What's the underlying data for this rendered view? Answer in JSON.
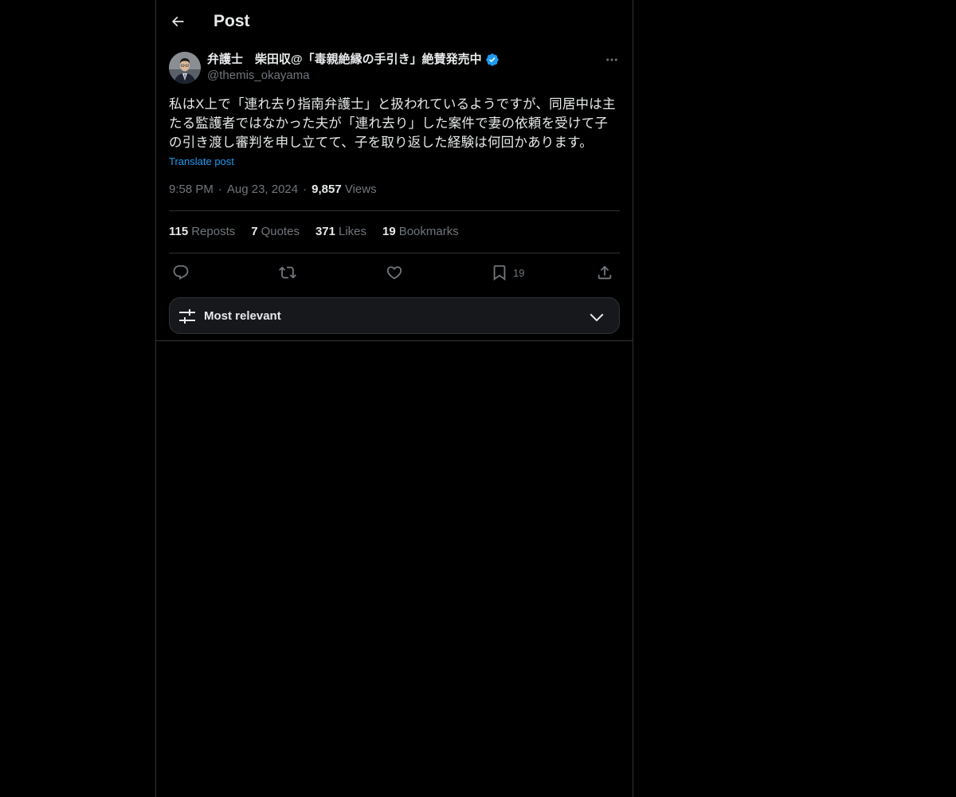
{
  "header": {
    "title": "Post"
  },
  "post": {
    "author_name": "弁護士　柴田収@「毒親絶縁の手引き」絶賛発売中",
    "handle": "@themis_okayama",
    "text": "私はX上で「連れ去り指南弁護士」と扱われているようですが、同居中は主たる監護者ではなかった夫が「連れ去り」した案件で妻の依頼を受けて子の引き渡し審判を申し立てて、子を取り返した経験は何回かあります。",
    "translate_label": "Translate post",
    "time": "9:58 PM",
    "date": "Aug 23, 2024",
    "views_count": "9,857",
    "views_label": "Views"
  },
  "stats": [
    {
      "count": "115",
      "label": "Reposts"
    },
    {
      "count": "7",
      "label": "Quotes"
    },
    {
      "count": "371",
      "label": "Likes"
    },
    {
      "count": "19",
      "label": "Bookmarks"
    }
  ],
  "actions": {
    "reply_icon": "reply-icon",
    "repost_icon": "repost-icon",
    "like_icon": "heart-icon",
    "bookmark_icon": "bookmark-icon",
    "bookmark_count": "19",
    "share_icon": "share-icon"
  },
  "sort": {
    "label": "Most relevant"
  },
  "colors": {
    "background": "#000000",
    "text": "#e7e9ea",
    "muted": "#71767b",
    "accent": "#1d9bf0",
    "border": "#2f3336"
  }
}
